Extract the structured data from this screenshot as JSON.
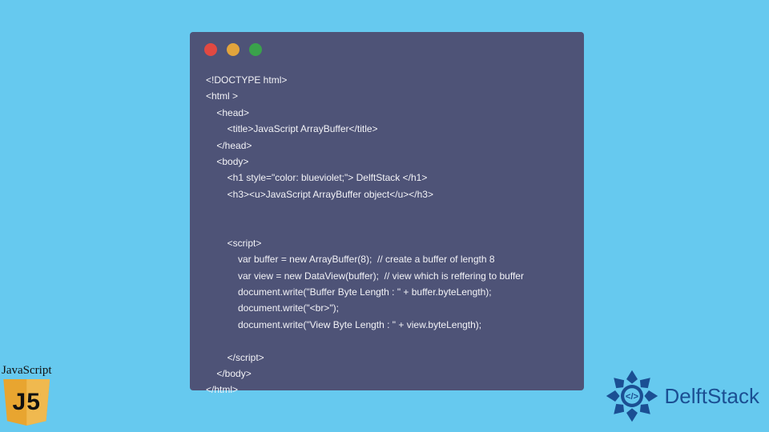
{
  "codeWindow": {
    "dots": [
      "red",
      "yellow",
      "green"
    ],
    "lines": [
      "<!DOCTYPE html>",
      "<html >",
      "    <head>",
      "        <title>JavaScript ArrayBuffer</title>",
      "    </head>",
      "    <body>",
      "        <h1 style=\"color: blueviolet;\"> DelftStack </h1>",
      "        <h3><u>JavaScript ArrayBuffer object</u></h3>",
      "",
      "",
      "        <script>",
      "            var buffer = new ArrayBuffer(8);  // create a buffer of length 8",
      "            var view = new DataView(buffer);  // view which is reffering to buffer",
      "            document.write(\"Buffer Byte Length : \" + buffer.byteLength);",
      "            document.write(\"<br>\");",
      "            document.write(\"View Byte Length : \" + view.byteLength);",
      "",
      "        </script>",
      "    </body>",
      "</html>"
    ]
  },
  "jsBadge": {
    "label": "JavaScript",
    "shieldText": "J5"
  },
  "delftBrand": {
    "text": "DelftStack"
  }
}
